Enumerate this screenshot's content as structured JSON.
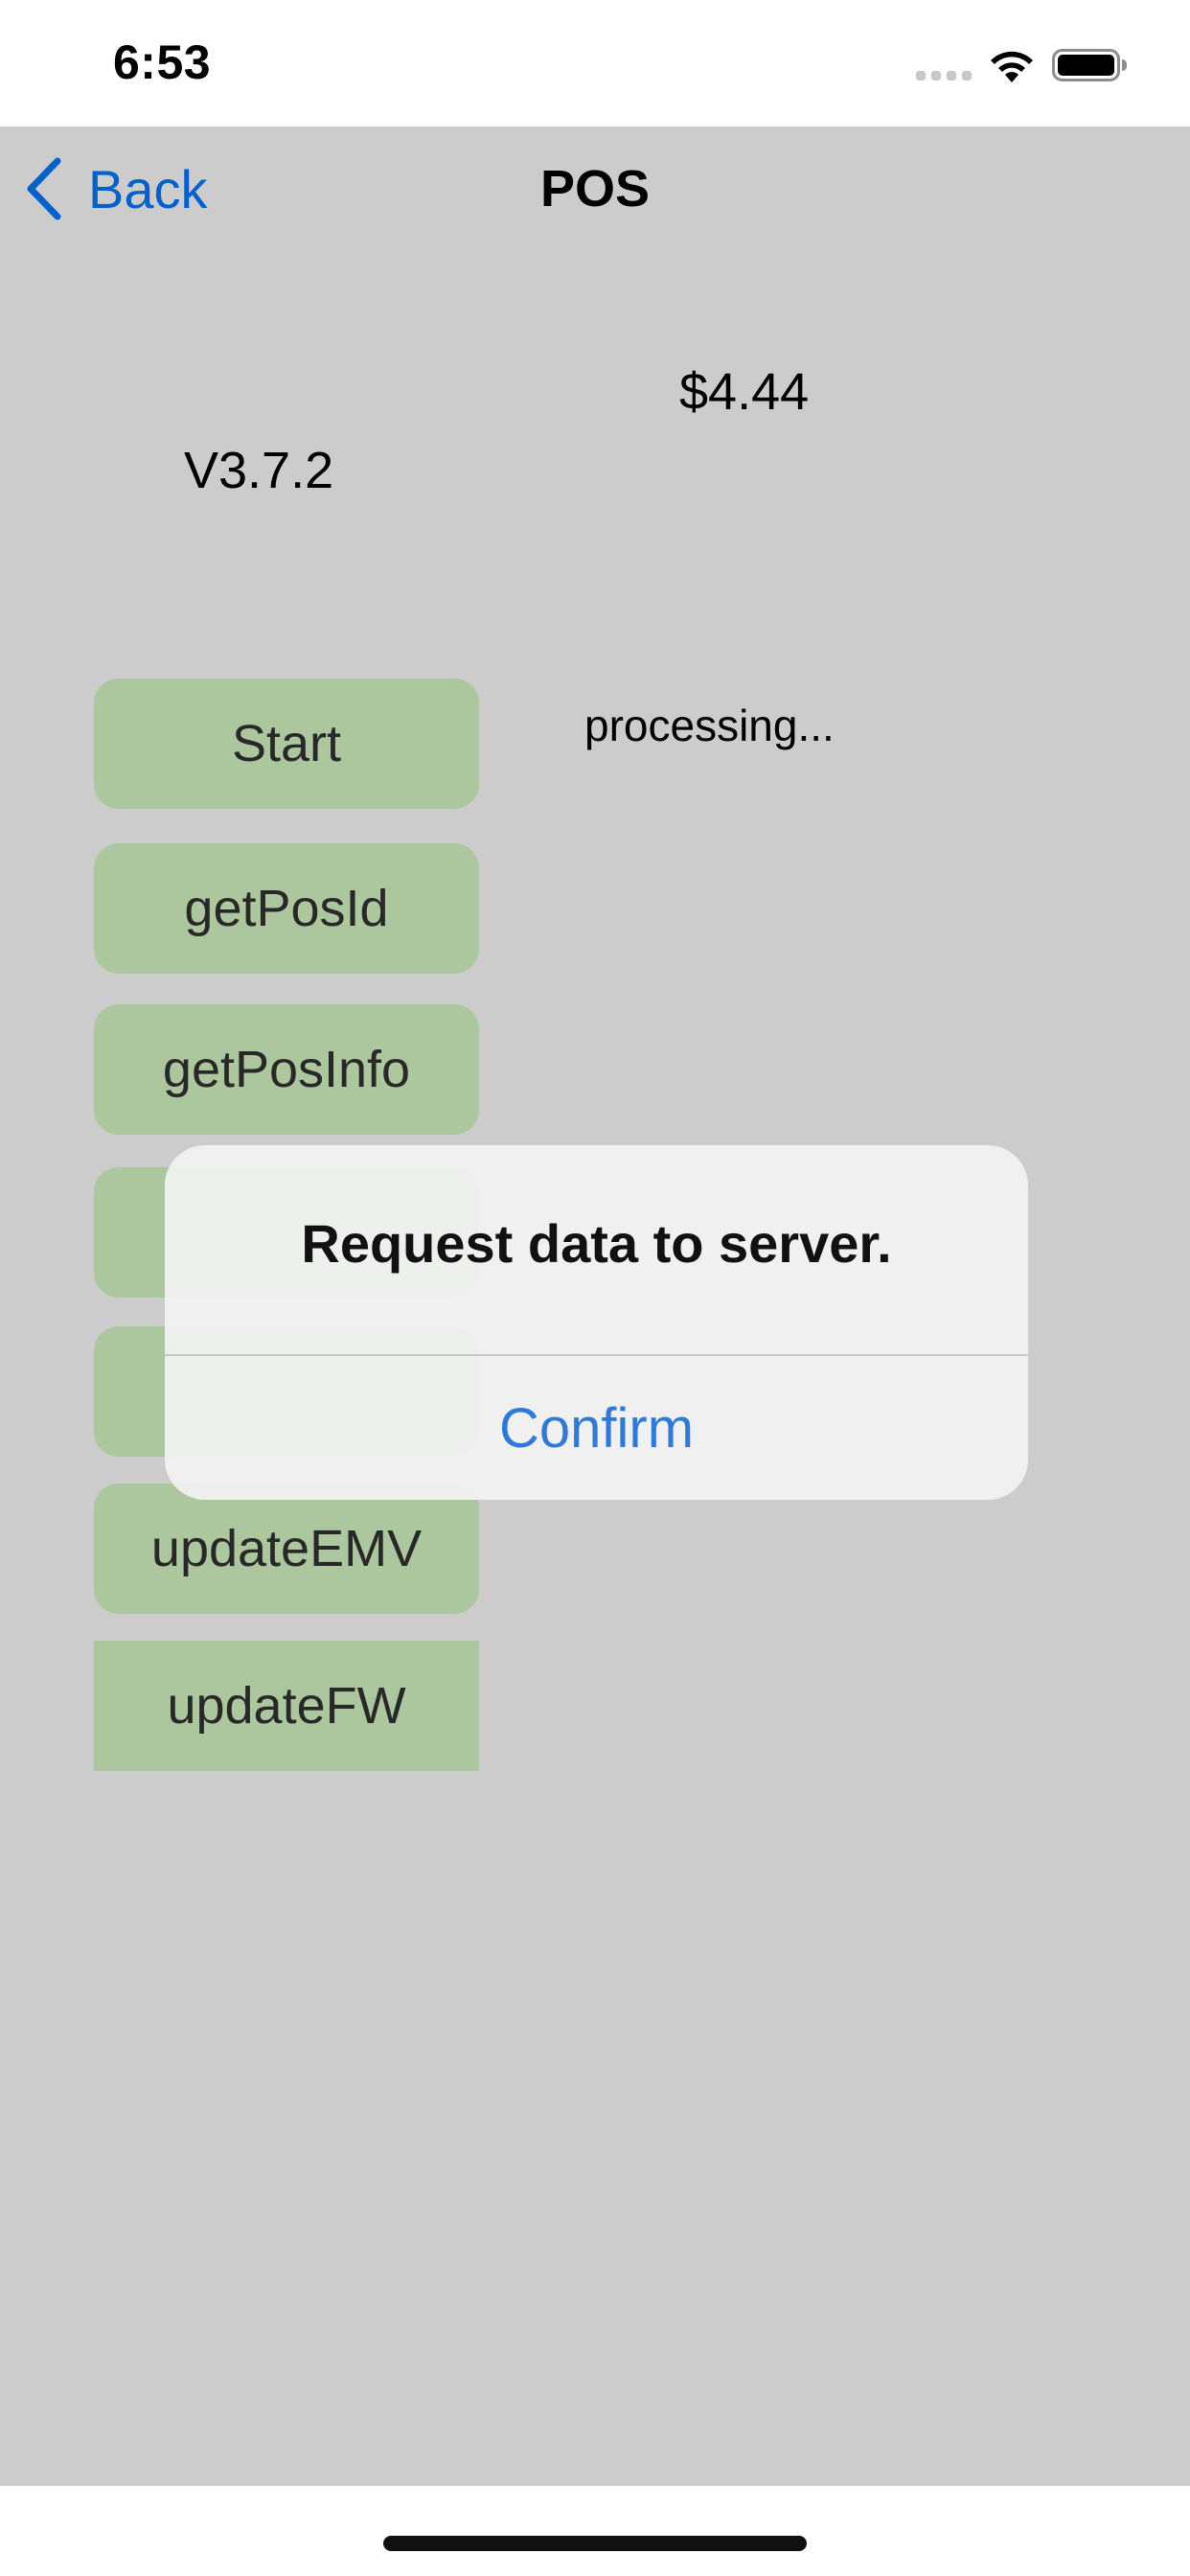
{
  "status_bar": {
    "time": "6:53",
    "signal_icon": "cellular-signal-icon",
    "wifi_icon": "wifi-icon",
    "battery_icon": "battery-icon"
  },
  "nav": {
    "back_label": "Back",
    "back_icon": "chevron-left-icon",
    "title": "POS"
  },
  "main": {
    "amount": "$4.44",
    "version": "V3.7.2",
    "status": "processing...",
    "buttons": [
      {
        "label": "Start"
      },
      {
        "label": "getPosId"
      },
      {
        "label": "getPosInfo"
      },
      {
        "label": ""
      },
      {
        "label": ""
      },
      {
        "label": "updateEMV"
      },
      {
        "label": "updateFW"
      }
    ]
  },
  "alert": {
    "message": "Request data to server.",
    "confirm_label": "Confirm"
  },
  "colors": {
    "button_background": "#d8f9c6",
    "link_blue": "#2f79d9",
    "dim_overlay": "rgba(0,0,0,0.2)"
  }
}
